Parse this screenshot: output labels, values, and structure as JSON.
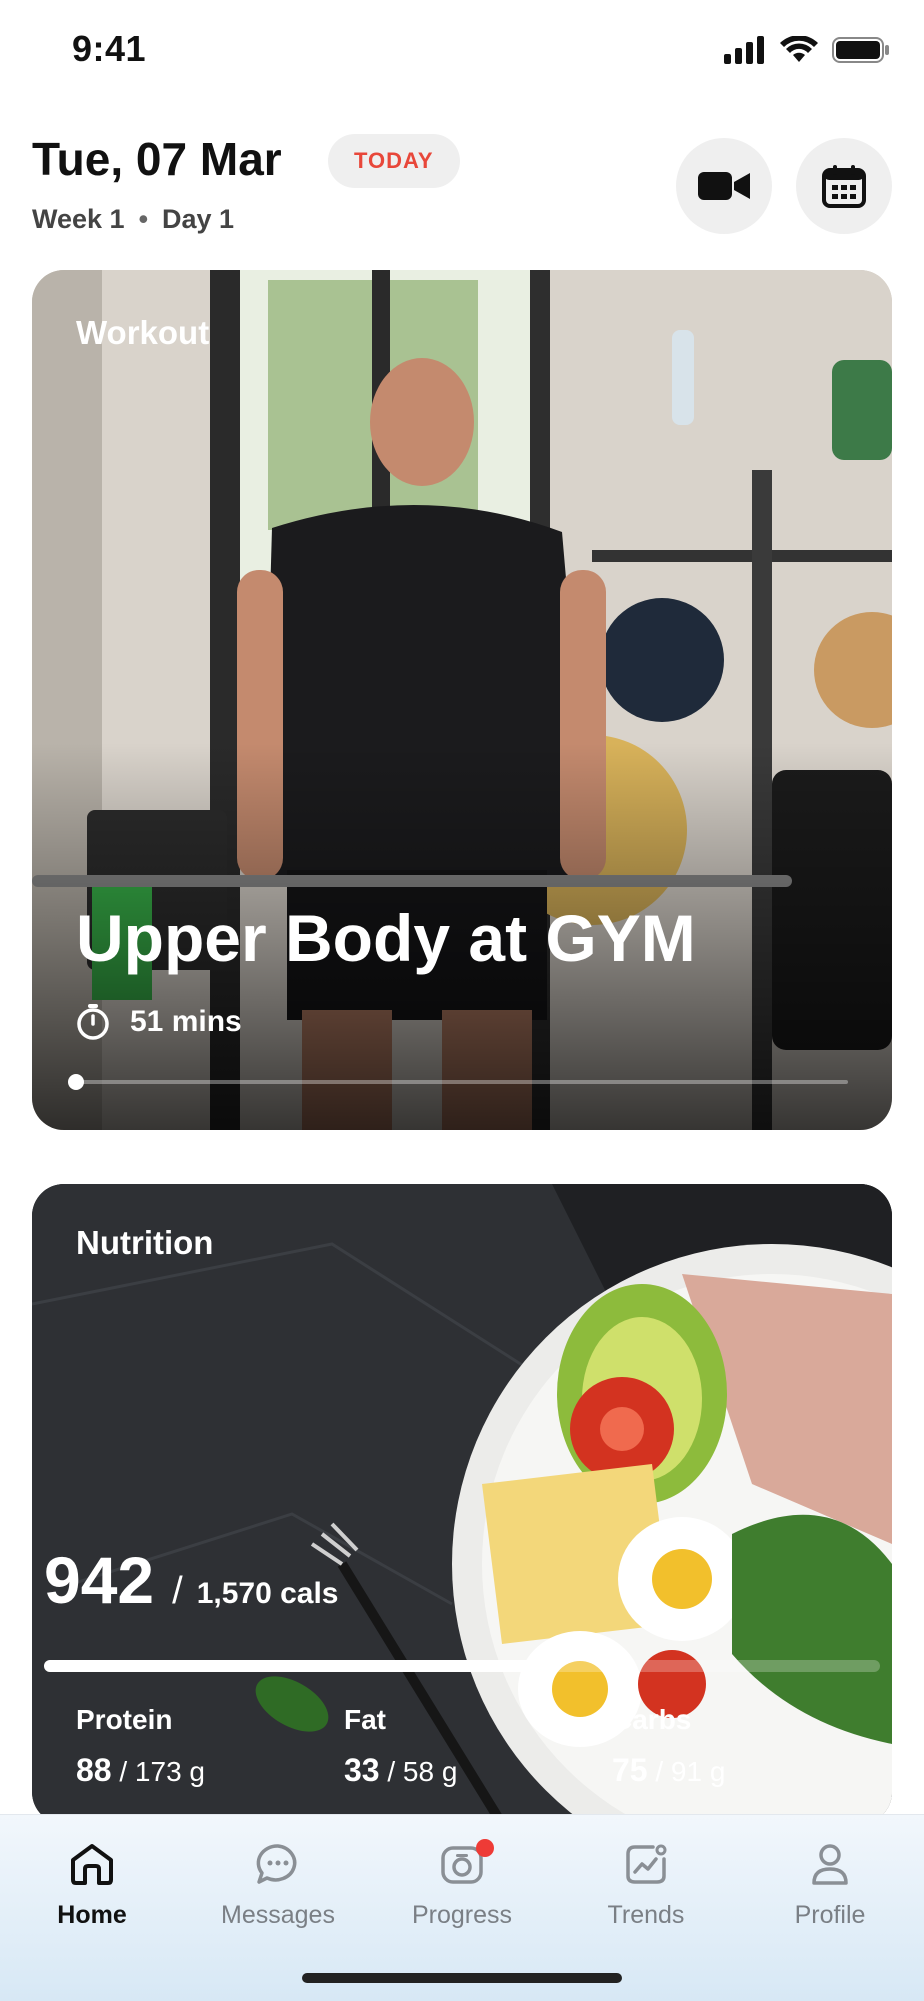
{
  "status_bar": {
    "time": "9:41"
  },
  "header": {
    "date": "Tue, 07 Mar",
    "badge": "TODAY",
    "week_label": "Week 1",
    "day_label": "Day 1"
  },
  "workout": {
    "section_label": "Workout",
    "title": "Upper Body at GYM",
    "duration": "51 mins",
    "progress_fraction": 0.0
  },
  "nutrition": {
    "section_label": "Nutrition",
    "calories_consumed": "942",
    "separator": "/",
    "calories_goal": "1,570 cals",
    "calories_fraction": 0.6,
    "macros": [
      {
        "name": "Protein",
        "value": "88",
        "goal": "/ 173 g"
      },
      {
        "name": "Fat",
        "value": "33",
        "goal": "/ 58 g"
      },
      {
        "name": "Carbs",
        "value": "75",
        "goal": "/ 91 g"
      }
    ]
  },
  "tabs": [
    {
      "label": "Home",
      "icon": "home-icon",
      "active": true
    },
    {
      "label": "Messages",
      "icon": "chat-icon",
      "active": false
    },
    {
      "label": "Progress",
      "icon": "camera-icon",
      "active": false,
      "badge": true
    },
    {
      "label": "Trends",
      "icon": "trends-icon",
      "active": false
    },
    {
      "label": "Profile",
      "icon": "profile-icon",
      "active": false
    }
  ],
  "colors": {
    "accent": "#e8473a",
    "badge_bg": "#efefef",
    "notification": "#ee3b36"
  }
}
